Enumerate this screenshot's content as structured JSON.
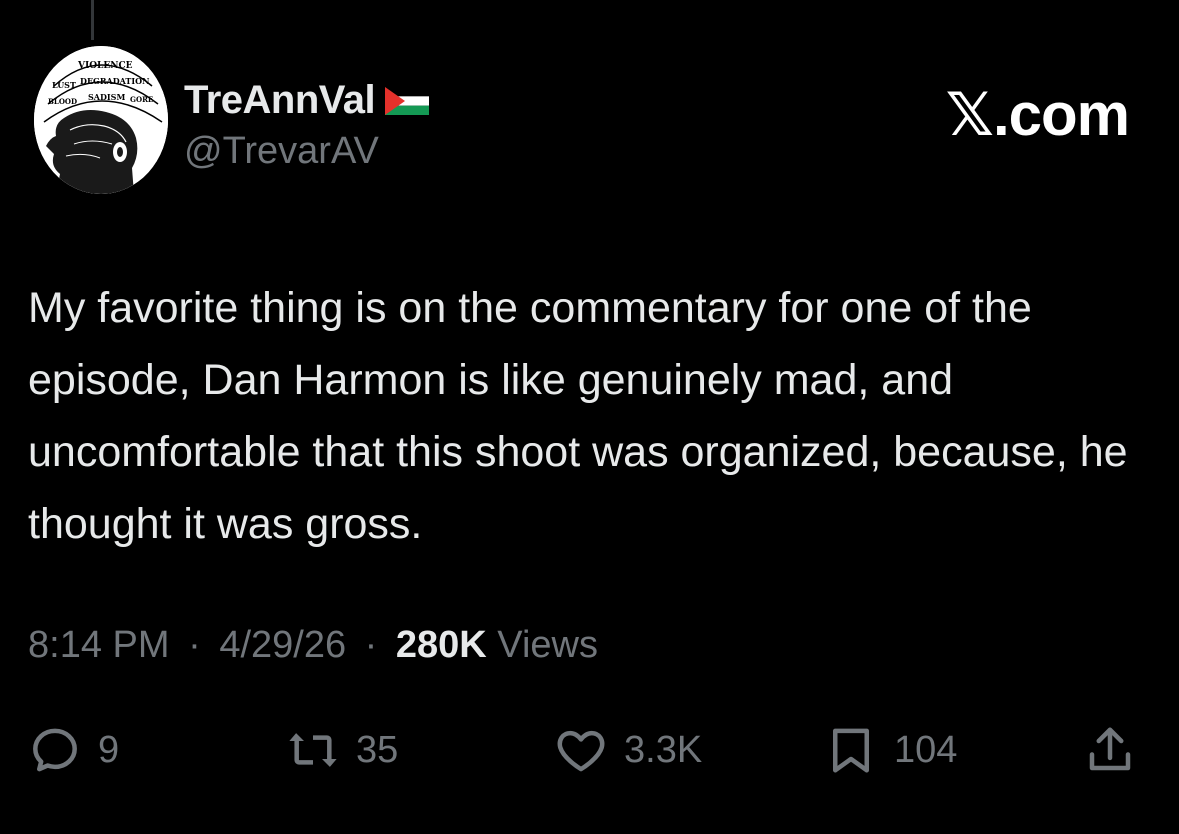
{
  "author": {
    "display_name": "TreAnnVal",
    "handle": "@TrevarAV",
    "flag_icon": "palestine-flag-icon",
    "avatar_text": [
      "VIOLENCE",
      "LUST",
      "DEGRADATION",
      "SADISM",
      "GORE",
      "BLOOD"
    ]
  },
  "brand": {
    "label": "𝕏.com"
  },
  "tweet": {
    "text": "My favorite thing is on the commentary for one of the episode, Dan Harmon is like genuinely mad, and uncomfortable that this shoot was organized, because, he thought it was gross."
  },
  "meta": {
    "time": "8:14 PM",
    "date": "4/29/26",
    "separator": "·",
    "views_count": "280K",
    "views_label": "Views"
  },
  "actions": {
    "replies": "9",
    "reposts": "35",
    "likes": "3.3K",
    "bookmarks": "104"
  },
  "colors": {
    "background": "#000000",
    "text_primary": "#e7e9ea",
    "text_secondary": "#71767b"
  }
}
